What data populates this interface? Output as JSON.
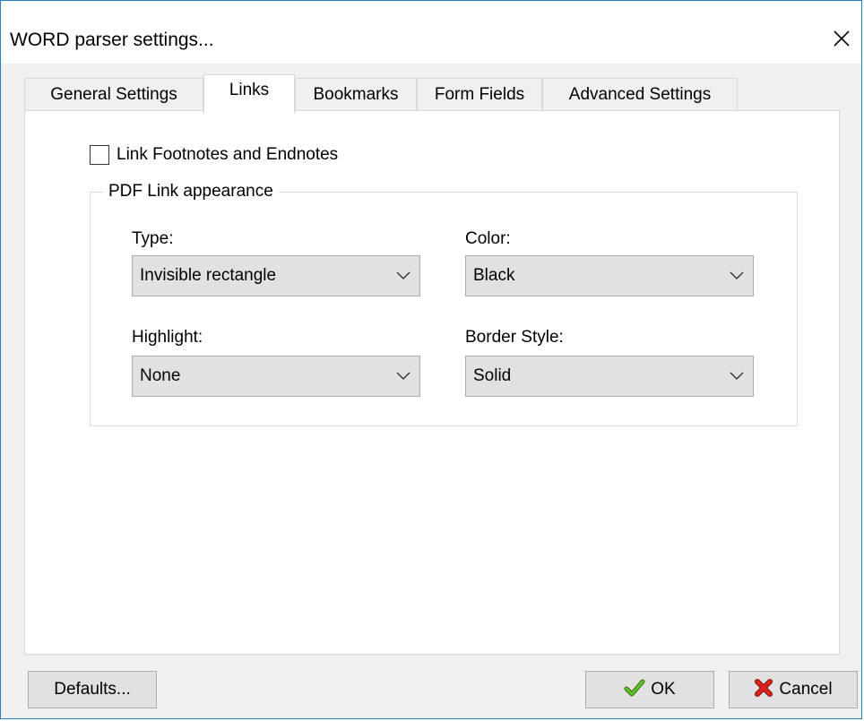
{
  "window": {
    "title": "WORD parser settings..."
  },
  "tabs": [
    {
      "label": "General Settings",
      "active": false
    },
    {
      "label": "Links",
      "active": true
    },
    {
      "label": "Bookmarks",
      "active": false
    },
    {
      "label": "Form Fields",
      "active": false
    },
    {
      "label": "Advanced Settings",
      "active": false
    }
  ],
  "links": {
    "footnotes_checkbox": {
      "label": "Link Footnotes and Endnotes",
      "checked": false
    },
    "group_title": "PDF Link appearance",
    "type": {
      "label": "Type:",
      "value": "Invisible rectangle"
    },
    "color": {
      "label": "Color:",
      "value": "Black"
    },
    "highlight": {
      "label": "Highlight:",
      "value": "None"
    },
    "border_style": {
      "label": "Border Style:",
      "value": "Solid"
    }
  },
  "buttons": {
    "defaults": "Defaults...",
    "ok": "OK",
    "cancel": "Cancel"
  },
  "icons": {
    "close": "close-icon",
    "dropdown": "chevron-down-icon",
    "ok": "checkmark-icon",
    "cancel": "cross-icon"
  },
  "colors": {
    "window_border": "#2b7fb8",
    "ok_check": "#4caf1e",
    "cancel_cross": "#d8201c"
  }
}
